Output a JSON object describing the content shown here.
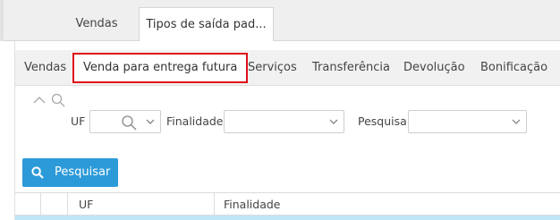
{
  "top_tabs": [
    "Vendas",
    "Tipos de saída pad..."
  ],
  "sub_tabs": [
    "Vendas",
    "Venda para entrega futura",
    "Serviços",
    "Transferência",
    "Devolução",
    "Bonificação"
  ],
  "filters": {
    "uf_label": "UF",
    "uf_value": "",
    "finalidade_label": "Finalidade",
    "finalidade_value": "",
    "pesquisa_label": "Pesquisa",
    "pesquisa_value": ""
  },
  "search_button": {
    "label": "Pesquisar",
    "icon": "search-icon"
  },
  "grid": {
    "columns": [
      "UF",
      "Finalidade"
    ]
  },
  "colors": {
    "accent": "#2c9ad8",
    "highlight": "#e0101a",
    "selected_row": "#bfe6f7"
  }
}
